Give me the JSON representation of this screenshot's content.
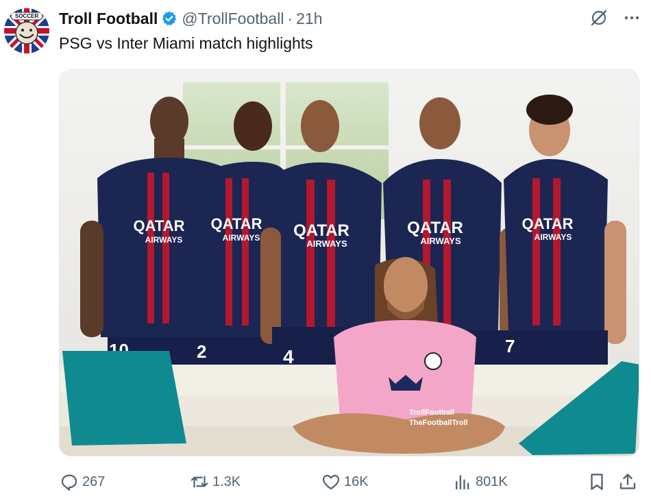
{
  "tweet": {
    "author_name": "Troll Football",
    "handle": "@TrollFootball",
    "separator": "·",
    "time": "21h",
    "text": "PSG vs Inter Miami match highlights"
  },
  "avatar": {
    "badge_text": "SOCCER"
  },
  "media": {
    "sponsor_line1": "QATAR",
    "sponsor_line2": "AIRWAYS",
    "watermark_twitter": "TrollFootball",
    "watermark_instagram": "TheFootballTroll",
    "shirt_numbers": [
      "10",
      "2",
      "4",
      "7"
    ]
  },
  "actions": {
    "replies": "267",
    "retweets": "1.3K",
    "likes": "16K",
    "views": "801K"
  },
  "colors": {
    "verified_blue": "#1d9bf0",
    "muted_text": "#536471",
    "psg_navy": "#1b2652",
    "psg_red": "#b3182e",
    "miami_pink": "#f4a6c8",
    "cushion_teal": "#0f8a90"
  },
  "icons": [
    "verified-badge-icon",
    "grok-icon",
    "more-icon",
    "reply-icon",
    "retweet-icon",
    "like-icon",
    "views-icon",
    "bookmark-icon",
    "share-icon"
  ]
}
